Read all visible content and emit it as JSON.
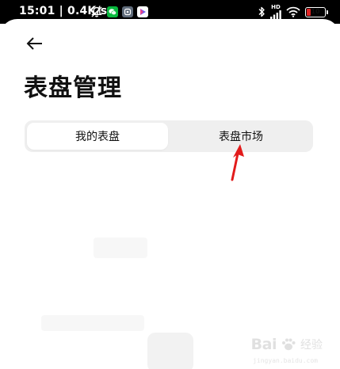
{
  "status_bar": {
    "time": "15:01 | 0.4K/s",
    "battery": "10",
    "hd": "HD",
    "icons_left": [
      "mute-off-icon",
      "wechat-icon",
      "app-icon",
      "play-store-icon"
    ],
    "icons_right": [
      "bluetooth-icon",
      "signal-icon",
      "wifi-icon",
      "battery-icon"
    ],
    "colors": {
      "wechat": "#09b83e",
      "app": "#5f6b7a",
      "play": "#6a5cf5",
      "battery_low": "#e02424"
    }
  },
  "header": {
    "back_icon": "arrow-left-icon",
    "title": "表盘管理"
  },
  "tabs": {
    "items": [
      {
        "label": "我的表盘",
        "active": true
      },
      {
        "label": "表盘市场",
        "active": false
      }
    ]
  },
  "annotation": {
    "color": "#e21b1b",
    "icon": "red-arrow-icon"
  },
  "watermark": {
    "brand": "Bai",
    "brand_suffix": "经验",
    "icon": "paw-icon",
    "sub": "jingyan.baidu.com"
  }
}
